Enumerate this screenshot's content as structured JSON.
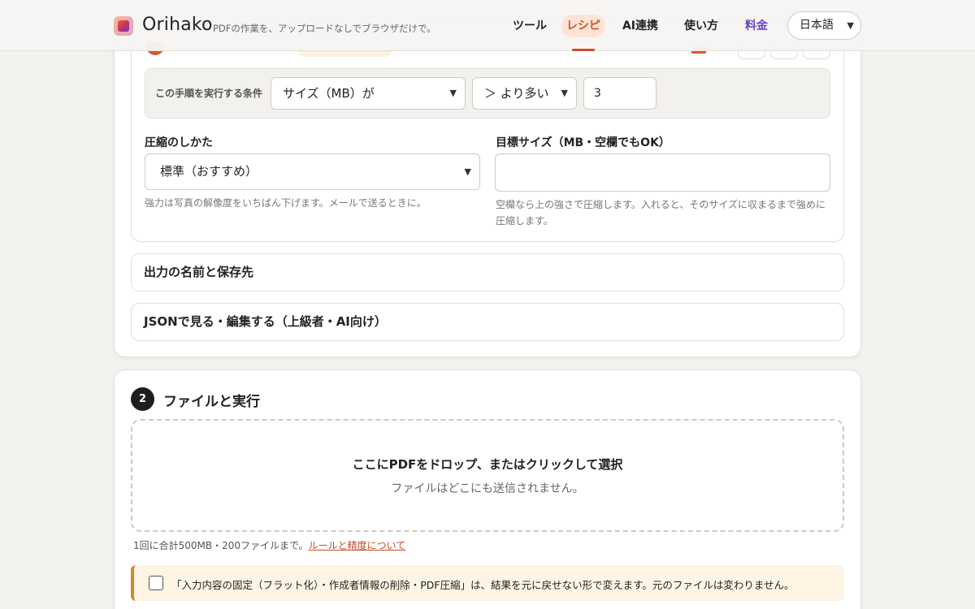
{
  "header": {
    "brand": "Orihako",
    "tagline": "PDFの作業を、アップロードなしでブラウザだけで。",
    "nav": {
      "tools": "ツール",
      "recipe": "レシピ",
      "ai": "AI連携",
      "howto": "使い方",
      "pricing": "料金"
    },
    "language": "日本語"
  },
  "recipe_step": {
    "condition": {
      "label": "この手順を実行する条件",
      "field": "サイズ（MB）が",
      "operator": "＞ より多い",
      "value": "3"
    },
    "compression": {
      "label": "圧縮のしかた",
      "selected": "標準（おすすめ）",
      "hint": "強力は写真の解像度をいちばん下げます。メールで送るときに。"
    },
    "target_size": {
      "label": "目標サイズ（MB・空欄でもOK）",
      "value": "",
      "hint": "空欄なら上の強さで圧縮します。入れると、そのサイズに収まるまで強めに圧縮します。"
    },
    "accordions": {
      "output": "出力の名前と保存先",
      "json": "JSONで見る・編集する（上級者・AI向け）"
    }
  },
  "file_step": {
    "number": "2",
    "title": "ファイルと実行",
    "dropzone": {
      "main": "ここにPDFをドロップ、またはクリックして選択",
      "sub": "ファイルはどこにも送信されません。"
    },
    "limit": "1回に合計500MB・200ファイルまで。",
    "limit_link": "ルールと精度について",
    "warning": "「入力内容の固定（フラット化）・作成者情報の削除・PDF圧縮」は、結果を元に戻せない形で変えます。元のファイルは変わりません。",
    "warning_checked": false
  },
  "colors": {
    "accent": "#d2522a",
    "pricing": "#6a43c7",
    "warning_bg": "#fdf4e3"
  }
}
